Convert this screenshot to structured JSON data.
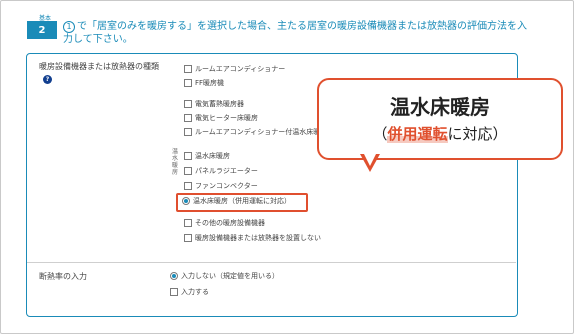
{
  "question": {
    "small_label": "基本",
    "number": "2",
    "ref": "1",
    "text": "で「居室のみを暖房する」を選択した場合、主たる居室の暖房設備機器または放熱器の評価方法を入力して下さい。"
  },
  "panel": {
    "label": "暖房設備機器または放熱器の種類",
    "help_icon": "question-icon",
    "options_group1": [
      "ルームエアコンディショナー",
      "FF暖房機"
    ],
    "options_group2": [
      "電気蓄熱暖房器",
      "電気ヒーター床暖房",
      "ルームエアコンディショナー付温水床暖房"
    ],
    "vertical_group_label": "温水暖房",
    "options_group3": [
      "温水床暖房",
      "パネルラジエーター",
      "ファンコンベクター"
    ],
    "selected_option": "温水床暖房（併用運転に対応）",
    "options_group4": [
      "その他の暖房設備機器",
      "暖房設備機器または放熱器を設置しない"
    ],
    "section2": {
      "label": "断熱率の入力",
      "radio_selected": "入力しない（規定値を用いる）",
      "option2": "入力する"
    }
  },
  "callout": {
    "title": "温水床暖房",
    "sub_open": "（",
    "sub_emphasis": "併用運転",
    "sub_rest": "に対応）"
  },
  "colors": {
    "accent": "#1a8bb8",
    "callout_border": "#e0502e",
    "help_icon": "#123f8f"
  }
}
